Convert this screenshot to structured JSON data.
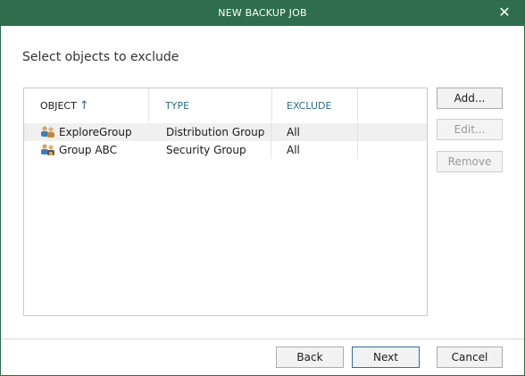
{
  "window": {
    "title": "NEW BACKUP JOB"
  },
  "page": {
    "heading": "Select objects to exclude"
  },
  "grid": {
    "columns": {
      "object": "OBJECT",
      "type": "TYPE",
      "exclude": "EXCLUDE"
    },
    "sort_indicator": "↑",
    "rows": [
      {
        "object": "ExploreGroup",
        "type": "Distribution Group",
        "exclude": "All",
        "icon": "group-icon"
      },
      {
        "object": "Group ABC",
        "type": "Security Group",
        "exclude": "All",
        "icon": "security-group-icon"
      }
    ]
  },
  "side_buttons": {
    "add": "Add...",
    "edit": "Edit...",
    "remove": "Remove"
  },
  "footer": {
    "back": "Back",
    "next": "Next",
    "cancel": "Cancel"
  },
  "colors": {
    "titlebar": "#2e6e4c",
    "header_link": "#2e6e8e",
    "selected_row": "#f0f0f0"
  }
}
